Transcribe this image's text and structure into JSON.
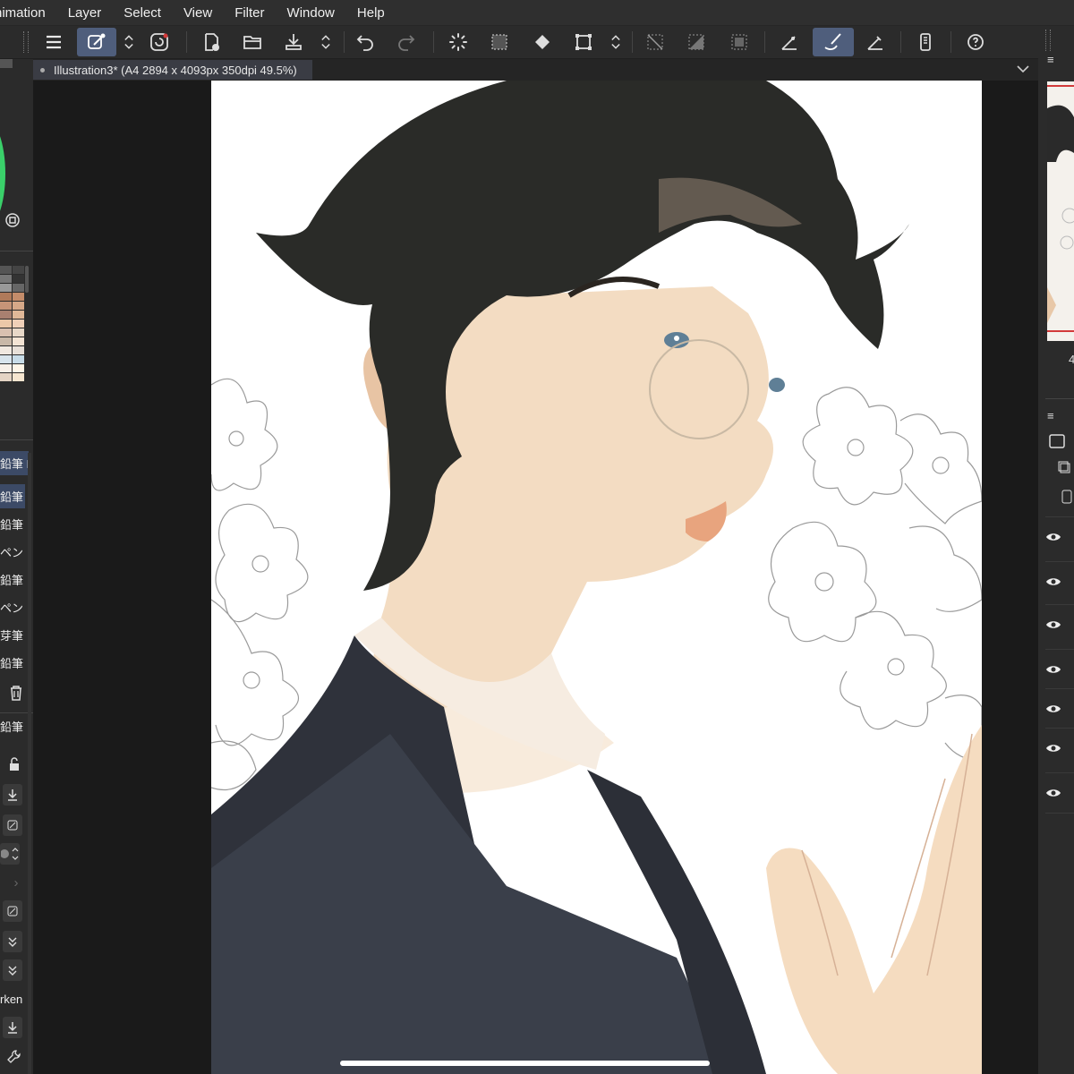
{
  "menu": {
    "items": [
      "nimation",
      "Layer",
      "Select",
      "View",
      "Filter",
      "Window",
      "Help"
    ]
  },
  "toolbar": {
    "buttons": [
      "menu-icon",
      "modifier-key-icon",
      "updown-icon",
      "companion-icon",
      "new-canvas-icon",
      "open-folder-icon",
      "save-icon",
      "updown-icon",
      "undo-icon",
      "redo-icon",
      "loading-icon",
      "select-all-icon",
      "fill-icon",
      "transform-icon",
      "updown-icon",
      "clear-selection-icon",
      "fill-layer-icon",
      "invert-selection-icon",
      "ruler-icon",
      "brush-icon",
      "snap-ruler-icon",
      "smartphone-icon",
      "help-icon"
    ]
  },
  "document": {
    "tab_title": "Illustration3* (A4 2894 x 4093px 350dpi 49.5%)"
  },
  "left_panel": {
    "brush_group_label": "鉛筆 R",
    "brushes": [
      {
        "label": "鉛筆 R",
        "selected": true
      },
      {
        "label": "鉛筆",
        "selected": false
      },
      {
        "label": "ペン",
        "selected": false
      },
      {
        "label": "鉛筆",
        "selected": false
      },
      {
        "label": "ペン",
        "selected": false
      },
      {
        "label": "芽筆",
        "selected": false
      },
      {
        "label": "鉛筆",
        "selected": false
      }
    ],
    "current_brush": "鉛筆 R",
    "setting_label": "rken",
    "swatches": [
      "#555555",
      "#444444",
      "#777777",
      "#333333",
      "#999999",
      "#666666",
      "#b07a5a",
      "#c48c6a",
      "#c69478",
      "#d6a888",
      "#a88070",
      "#e0b898",
      "#ecc8a8",
      "#f0d0b8",
      "#d8c0b0",
      "#e8d8c8",
      "#c8b8a8",
      "#f4e4d4",
      "#f0e8e0",
      "#e8e0d8",
      "#d8e4ec",
      "#c8dce8",
      "#f8f0e8",
      "#fff6e8",
      "#e4d4c4",
      "#f6e6d0"
    ]
  },
  "right_panel": {
    "navigator_digit": "4"
  },
  "colors": {
    "accent": "#4f5e7c",
    "brand_green": "#3ad06a"
  }
}
